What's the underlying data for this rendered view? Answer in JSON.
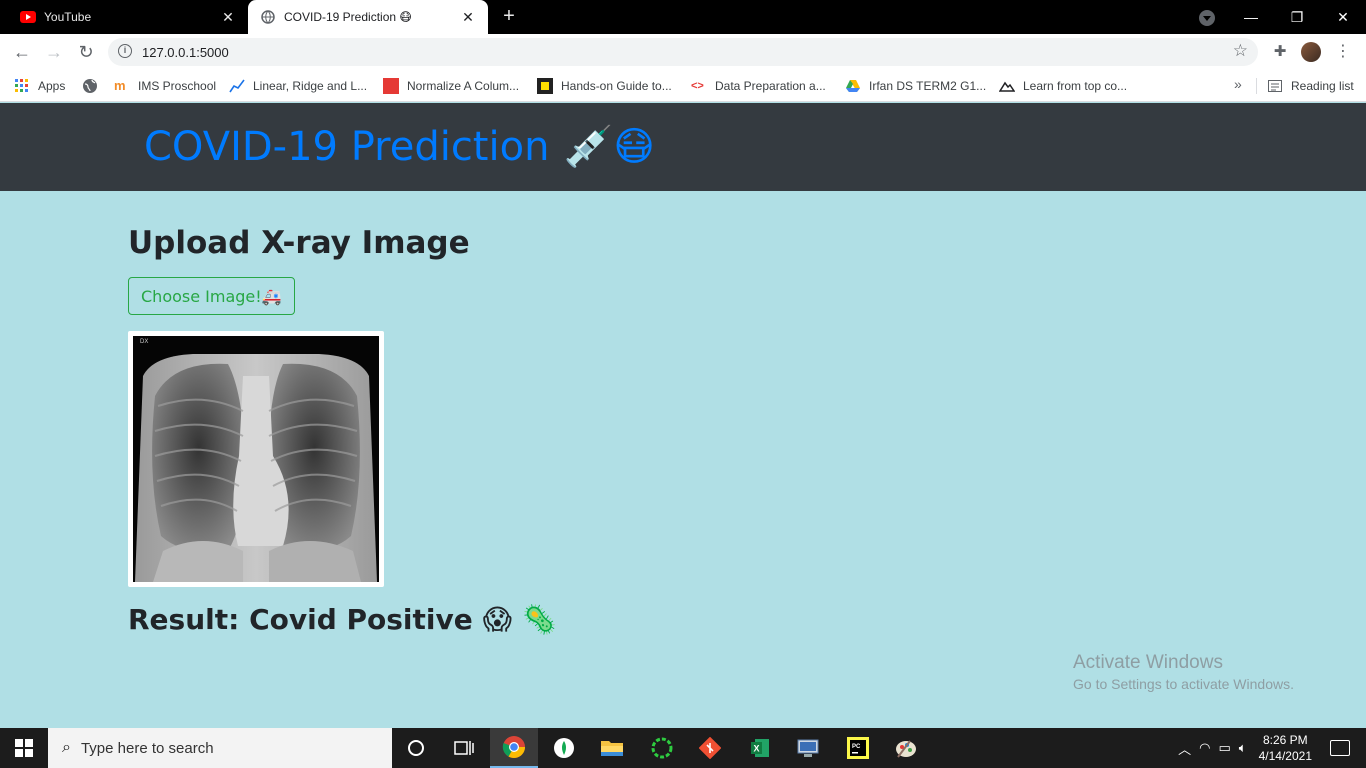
{
  "browser": {
    "tabs": [
      {
        "title": "YouTube",
        "active": false,
        "favicon": "youtube-icon"
      },
      {
        "title": "COVID-19 Prediction 😷",
        "active": true,
        "favicon": "globe-icon"
      }
    ],
    "url": "127.0.0.1:5000",
    "bookmarks": [
      {
        "label": "Apps",
        "icon": "apps-grid-icon"
      },
      {
        "label": "",
        "icon": "globe-icon"
      },
      {
        "label": "IMS Proschool",
        "icon": "ims-icon"
      },
      {
        "label": "Linear, Ridge and L...",
        "icon": "chart-line-icon"
      },
      {
        "label": "Normalize A Colum...",
        "icon": "red-square-icon"
      },
      {
        "label": "Hands-on Guide to...",
        "icon": "yellow-square-icon"
      },
      {
        "label": "Data Preparation a...",
        "icon": "code-icon"
      },
      {
        "label": "Irfan DS TERM2 G1...",
        "icon": "drive-icon"
      },
      {
        "label": "Learn from top co...",
        "icon": "mountain-icon"
      }
    ],
    "reading_list": "Reading list"
  },
  "page": {
    "brand": "COVID-19 Prediction",
    "brand_emoji": "💉😷",
    "upload_title": "Upload X-ray Image",
    "choose_button": "Choose Image!",
    "choose_emoji": "🚑",
    "xray_marker": "DX",
    "result_text": "Result: Covid Positive",
    "result_emoji_1": "😱",
    "result_emoji_2": "🦠"
  },
  "watermark": {
    "line1": "Activate Windows",
    "line2": "Go to Settings to activate Windows."
  },
  "taskbar": {
    "search_placeholder": "Type here to search",
    "time": "8:26 PM",
    "date": "4/14/2021",
    "apps": [
      "cortana-icon",
      "task-view-icon",
      "chrome-icon",
      "mongodb-icon",
      "file-explorer-icon",
      "refresh-app-icon",
      "git-icon",
      "excel-icon",
      "remote-desktop-icon",
      "pycharm-icon",
      "paint-icon"
    ]
  },
  "colors": {
    "page_bg": "#b0dfe5",
    "navbar_bg": "#343a40",
    "brand": "#007bff",
    "button_outline": "#28a745"
  }
}
